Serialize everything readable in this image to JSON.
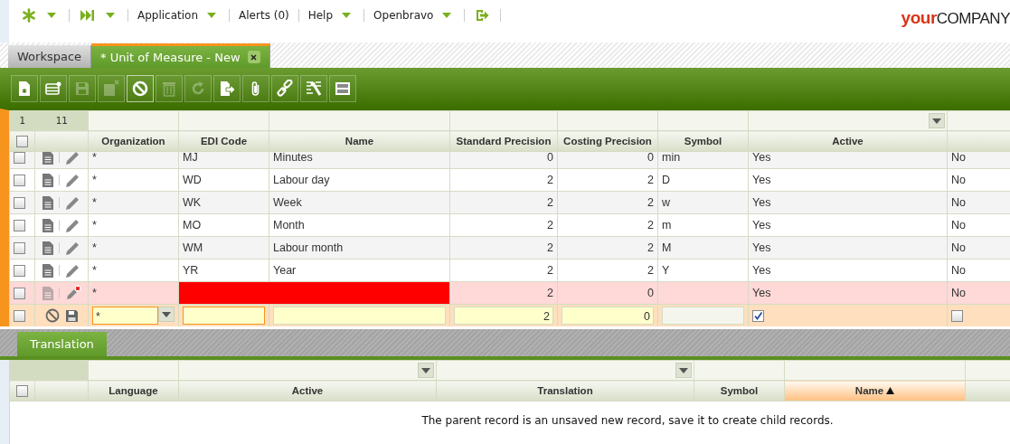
{
  "top_menu": [
    {
      "label": "Application",
      "has_menu": true
    },
    {
      "label": "Alerts (0)",
      "has_menu": false
    },
    {
      "label": "Help",
      "has_menu": true
    },
    {
      "label": "Openbravo",
      "has_menu": true
    }
  ],
  "logo": {
    "first": "your",
    "second": "COMPANY"
  },
  "tabs": [
    {
      "label": "Workspace",
      "selected": false,
      "closable": false
    },
    {
      "label": "* Unit of Measure - New",
      "selected": true,
      "closable": true
    }
  ],
  "toolbar": [
    {
      "kind": "new-document",
      "disabled": false
    },
    {
      "kind": "new-row",
      "disabled": false
    },
    {
      "kind": "save",
      "disabled": true
    },
    {
      "kind": "save-close",
      "disabled": true
    },
    {
      "kind": "cancel",
      "disabled": false
    },
    {
      "kind": "delete",
      "disabled": true
    },
    {
      "kind": "refresh",
      "disabled": true
    },
    {
      "kind": "export",
      "disabled": false
    },
    {
      "kind": "attach",
      "disabled": false
    },
    {
      "kind": "link",
      "disabled": false
    },
    {
      "kind": "tools",
      "disabled": false
    },
    {
      "kind": "layout",
      "disabled": false
    }
  ],
  "grid": {
    "selected_count": "1",
    "total_count": "11",
    "select_all_checked": false,
    "columns": [
      {
        "label": "Organization",
        "filter_dropdown": false
      },
      {
        "label": "EDI Code",
        "filter_dropdown": false
      },
      {
        "label": "Name",
        "filter_dropdown": false
      },
      {
        "label": "Standard Precision",
        "filter_dropdown": false
      },
      {
        "label": "Costing Precision",
        "filter_dropdown": false
      },
      {
        "label": "Symbol",
        "filter_dropdown": false
      },
      {
        "label": "Active",
        "filter_dropdown": true
      }
    ],
    "rows": [
      {
        "kind": "record",
        "organization": "*",
        "edi_code": "MJ",
        "name": "Minutes",
        "standard_precision": "0",
        "costing_precision": "0",
        "symbol": "min",
        "active": "Yes",
        "column_9": "No"
      },
      {
        "kind": "record",
        "organization": "*",
        "edi_code": "WD",
        "name": "Labour day",
        "standard_precision": "2",
        "costing_precision": "2",
        "symbol": "D",
        "active": "Yes",
        "column_9": "No"
      },
      {
        "kind": "record",
        "organization": "*",
        "edi_code": "WK",
        "name": "Week",
        "standard_precision": "2",
        "costing_precision": "2",
        "symbol": "w",
        "active": "Yes",
        "column_9": "No"
      },
      {
        "kind": "record",
        "organization": "*",
        "edi_code": "MO",
        "name": "Month",
        "standard_precision": "2",
        "costing_precision": "2",
        "symbol": "m",
        "active": "Yes",
        "column_9": "No"
      },
      {
        "kind": "record",
        "organization": "*",
        "edi_code": "WM",
        "name": "Labour month",
        "standard_precision": "2",
        "costing_precision": "2",
        "symbol": "M",
        "active": "Yes",
        "column_9": "No"
      },
      {
        "kind": "record",
        "organization": "*",
        "edi_code": "YR",
        "name": "Year",
        "standard_precision": "2",
        "costing_precision": "2",
        "symbol": "Y",
        "active": "Yes",
        "column_9": "No"
      },
      {
        "kind": "error",
        "organization": "*",
        "standard_precision": "2",
        "costing_precision": "0",
        "active": "Yes",
        "column_9": "No"
      },
      {
        "kind": "edit",
        "organization": "*",
        "standard_precision": "2",
        "costing_precision": "0",
        "active_checked": true,
        "column_9_checked": false
      }
    ]
  },
  "subtab": {
    "label": "Translation",
    "selected": true
  },
  "subgrid": {
    "select_all_checked": false,
    "columns": [
      {
        "label": "Language",
        "filter_dropdown": false,
        "sorted": false
      },
      {
        "label": "Active",
        "filter_dropdown": true,
        "sorted": false
      },
      {
        "label": "Translation",
        "filter_dropdown": true,
        "sorted": false
      },
      {
        "label": "Symbol",
        "filter_dropdown": false,
        "sorted": false
      },
      {
        "label": "Name",
        "filter_dropdown": false,
        "sorted": true
      }
    ],
    "message": "The parent record is an unsaved new record, save it to create child records."
  }
}
